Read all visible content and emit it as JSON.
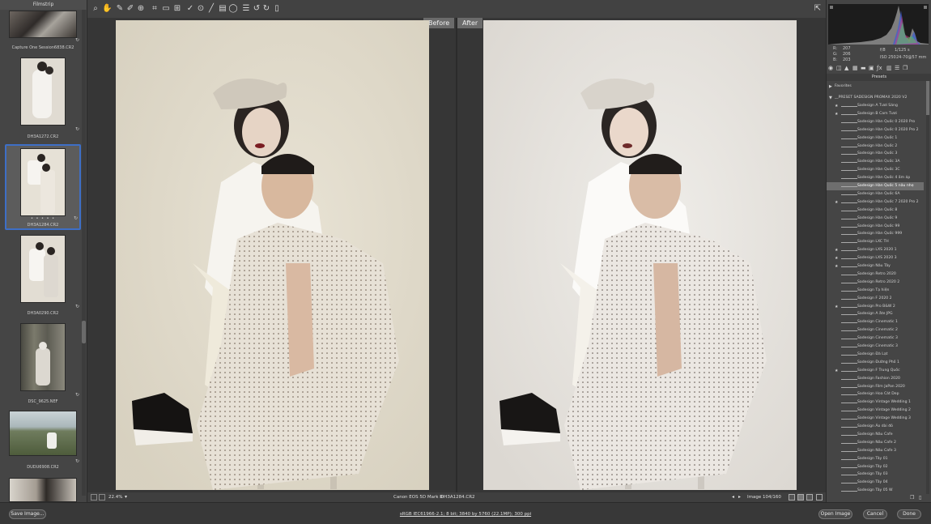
{
  "filmstrip": {
    "title": "Filmstrip",
    "items": [
      {
        "label": "Capture One Session6838.CR2",
        "stars": ""
      },
      {
        "label": "DH3A1272.CR2",
        "stars": ""
      },
      {
        "label": "DH3A1284.CR2",
        "stars": "• • • • •"
      },
      {
        "label": "DH3A0290.CR2",
        "stars": ""
      },
      {
        "label": "DSC_9625.NEF",
        "stars": ""
      },
      {
        "label": "DUDU6908.CR2",
        "stars": ""
      }
    ]
  },
  "toolbar": {
    "icons": [
      "zoom-icon",
      "hand-icon",
      "white-balance-icon",
      "color-sampler-icon",
      "target-adjust-icon",
      "crop-icon",
      "straighten-icon",
      "transform-icon",
      "spot-removal-icon",
      "red-eye-icon",
      "adjustment-brush-icon",
      "graduated-filter-icon",
      "radial-filter-icon",
      "preferences-icon",
      "rotate-left-icon",
      "rotate-right-icon",
      "trash-icon"
    ],
    "fullscreen_icon": "fullscreen-icon"
  },
  "canvas": {
    "before_label": "Before",
    "after_label": "After"
  },
  "statusbar": {
    "zoom": "22.4%",
    "camera": "Canon EOS 5D Mark III",
    "filename": "DH3A1284.CR2",
    "image_counter": "Image 104/160"
  },
  "readout": {
    "r_label": "R:",
    "r_val": "207",
    "g_label": "G:",
    "g_val": "206",
    "b_label": "B:",
    "b_val": "203",
    "aperture": "f/8",
    "shutter": "1/125 s",
    "iso": "ISO 250",
    "lens": "24-70@57 mm"
  },
  "presets": {
    "header": "Presets",
    "favorites": "Favorites",
    "group": "__PRESET SADESIGN PROMAX 2020 V2",
    "items": [
      {
        "name": "Sadesign A Tươi Sáng",
        "star": true
      },
      {
        "name": "Sadesign B  Cam Tươi",
        "star": true
      },
      {
        "name": "Sadesign Hàn Quốc 0 2020 Pro",
        "star": false
      },
      {
        "name": "Sadesign Hàn Quốc 0 2020 Pro 2",
        "star": false
      },
      {
        "name": "Sadesign Hàn Quốc 1",
        "star": false
      },
      {
        "name": "Sadesign Hàn Quốc 2",
        "star": false
      },
      {
        "name": "Sadesign Hàn Quốc 3",
        "star": false
      },
      {
        "name": "Sadesign Hàn Quốc 3A",
        "star": false
      },
      {
        "name": "Sadesign Hàn Quốc 3C",
        "star": false
      },
      {
        "name": "Sadesign Hàn Quốc 4 ấm áp",
        "star": false
      },
      {
        "name": "Sadesign Hàn Quốc 5 nâu nhẹ",
        "star": false,
        "selected": true
      },
      {
        "name": "Sadesign Hàn Quốc 6A",
        "star": false
      },
      {
        "name": "Sadesign Hàn Quốc 7 2020 Pro 2",
        "star": true
      },
      {
        "name": "Sadesign Hàn Quốc 8",
        "star": false
      },
      {
        "name": "Sadesign Hàn Quốc 9",
        "star": false
      },
      {
        "name": "Sadesign Hàn Quốc 99",
        "star": false
      },
      {
        "name": "Sadesign Hàn Quốc 999",
        "star": false
      },
      {
        "name": "Sadesign LXC  TH",
        "star": false
      },
      {
        "name": "Sadesign LXS 2020 1",
        "star": true
      },
      {
        "name": "Sadesign LXS 2020 3",
        "star": true
      },
      {
        "name": "Sadesign Nâu Tây",
        "star": true
      },
      {
        "name": "Sadesign Retro 2020",
        "star": false
      },
      {
        "name": "Sadesign Retro 2020 2",
        "star": false
      },
      {
        "name": "Sadesign Tạ hiện",
        "star": false
      },
      {
        "name": "Sadesign  F 2020 2",
        "star": false
      },
      {
        "name": "Sadesign  Pro B&W 2",
        "star": true
      },
      {
        "name": "Sadesign  A ắte JPG",
        "star": false
      },
      {
        "name": "Sadesign Cinematic 1",
        "star": false
      },
      {
        "name": "Sadesign Cinematic 2",
        "star": false
      },
      {
        "name": "Sadesign Cinematic 3",
        "star": false
      },
      {
        "name": "Sadesign Cinematic 3",
        "star": false
      },
      {
        "name": "Sadesign Đà Lạt",
        "star": false
      },
      {
        "name": "Sadesign Đường Phố 1",
        "star": false
      },
      {
        "name": "Sadesign F Trung Quốc",
        "star": true
      },
      {
        "name": "Sadesign Fashion 2020",
        "star": false
      },
      {
        "name": "Sadesign Film JaPan 2020",
        "star": false
      },
      {
        "name": "Sadesign Hoa Cát Dep",
        "star": false
      },
      {
        "name": "Sadesign Vintage Wedding 1",
        "star": false
      },
      {
        "name": "Sadesign Vintage Wedding 2",
        "star": false
      },
      {
        "name": "Sadesign Vintage Wedding 3",
        "star": false
      },
      {
        "name": "Sadesign Áo dài đỏ",
        "star": false
      },
      {
        "name": "Sadesign Nâu Cafe",
        "star": false
      },
      {
        "name": "Sadesign Nâu Cafe 2",
        "star": false
      },
      {
        "name": "Sadesign Nâu Cafe 3",
        "star": false
      },
      {
        "name": "Sadesign Tây 01",
        "star": false
      },
      {
        "name": "Sadesign Tây 02",
        "star": false
      },
      {
        "name": "Sadesign Tây 03",
        "star": false
      },
      {
        "name": "Sadesign Tây 04",
        "star": false
      },
      {
        "name": "Sadesign Tây 05 W",
        "star": false
      }
    ]
  },
  "bottombar": {
    "save_label": "Save Image...",
    "workflow": "sRGB IEC61966-2.1; 8 bit; 3840 by 5760 (22.1MP); 300 ppi",
    "open_label": "Open Image",
    "cancel_label": "Cancel",
    "done_label": "Done"
  }
}
